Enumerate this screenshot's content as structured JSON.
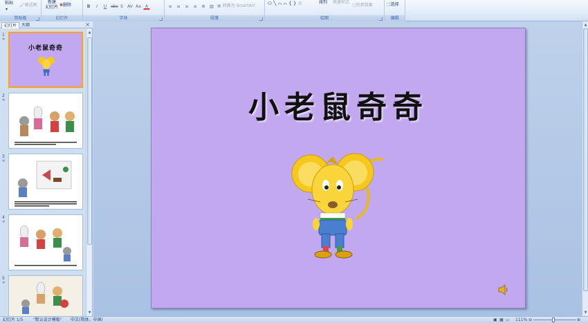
{
  "ribbon": {
    "clipboard": {
      "paste": "粘贴",
      "format_painter": "格式刷",
      "group": "剪贴板"
    },
    "slides": {
      "new_slide_line1": "新建",
      "new_slide_line2": "幻灯片",
      "delete": "删除",
      "group": "幻灯片"
    },
    "font": {
      "group": "字体"
    },
    "paragraph": {
      "convert_smartart": "转换为 SmartArt",
      "group": "段落"
    },
    "drawing": {
      "arrange": "排列",
      "quick_styles": "快速样式",
      "shape_effects": "形状效果",
      "group": "绘图"
    },
    "editing": {
      "select": "选择",
      "group": "编辑"
    }
  },
  "pane": {
    "tabs": [
      "幻灯片",
      "大纲"
    ],
    "close": "×",
    "thumbnails": [
      {
        "num": "1",
        "title": "小老鼠奇奇"
      },
      {
        "num": "2"
      },
      {
        "num": "3"
      },
      {
        "num": "4"
      },
      {
        "num": "5"
      }
    ]
  },
  "slide": {
    "title": "小老鼠奇奇",
    "background": "#c1a8ef"
  },
  "status": {
    "slide_info": "幻灯片 1/5",
    "theme": "\"默认设计模板\"",
    "language": "中文(简体，中国)",
    "zoom": "111%"
  },
  "icons": [
    "paste-icon",
    "format-painter-icon",
    "new-slide-icon",
    "delete-icon",
    "speaker-icon"
  ]
}
